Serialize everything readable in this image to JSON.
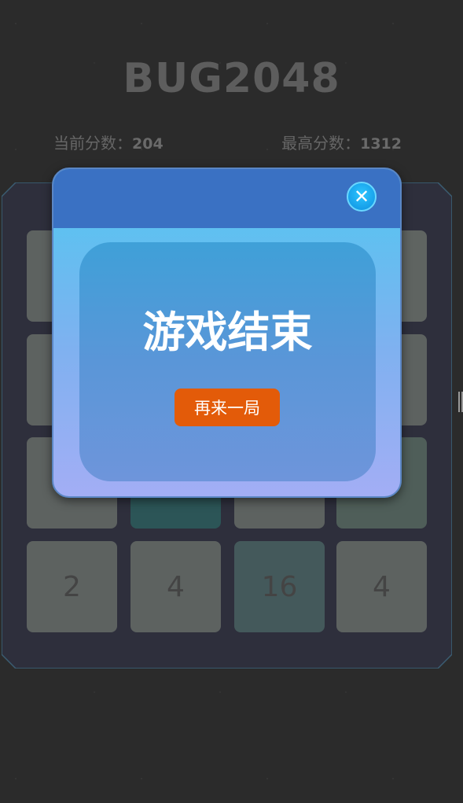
{
  "game": {
    "title": "BUG2048",
    "current_score_label": "当前分数：",
    "current_score": "204",
    "best_score_label": "最高分数：",
    "best_score": "1312"
  },
  "board": {
    "visible_bottom_row": [
      "2",
      "4",
      "16",
      "4"
    ]
  },
  "modal": {
    "close_icon": "✕",
    "title": "游戏结束",
    "restart_label": "再来一局"
  },
  "colors": {
    "modal_header": "#3a71c3",
    "restart_button": "#e35b09",
    "close_button": "#0d8fe0"
  }
}
